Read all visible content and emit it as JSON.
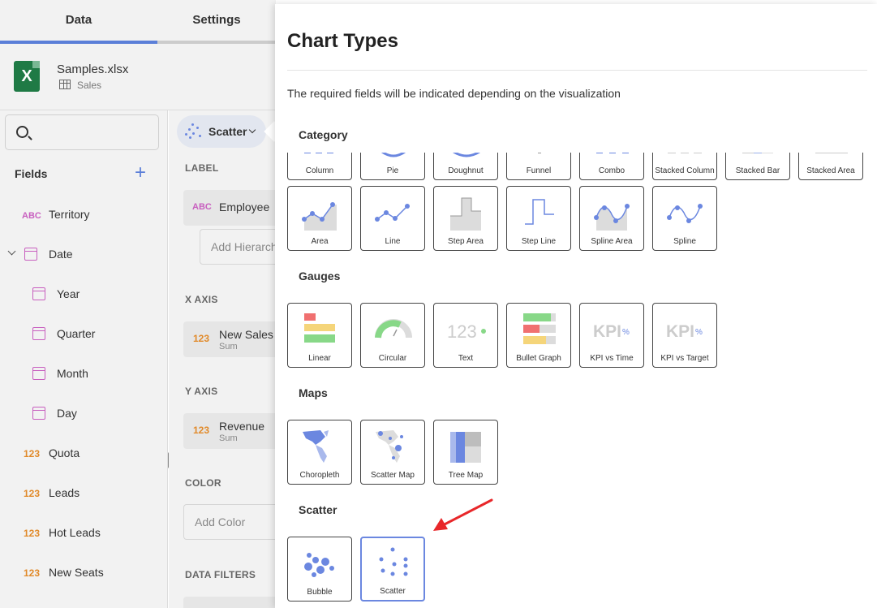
{
  "tabs": {
    "data": "Data",
    "settings": "Settings"
  },
  "source": {
    "file": "Samples.xlsx",
    "sheet": "Sales"
  },
  "fields_title": "Fields",
  "fields": [
    {
      "type": "ABC",
      "label": "Territory"
    },
    {
      "type": "date",
      "label": "Date"
    },
    {
      "type": "date",
      "label": "Year"
    },
    {
      "type": "date",
      "label": "Quarter"
    },
    {
      "type": "date",
      "label": "Month"
    },
    {
      "type": "date",
      "label": "Day"
    },
    {
      "type": "123",
      "label": "Quota"
    },
    {
      "type": "123",
      "label": "Leads"
    },
    {
      "type": "123",
      "label": "Hot Leads"
    },
    {
      "type": "123",
      "label": "New Seats"
    }
  ],
  "viz": {
    "selected": "Scatter",
    "label_section": "LABEL",
    "label_field": {
      "type": "ABC",
      "name": "Employee"
    },
    "hierarchy_placeholder": "Add Hierarchy",
    "x_axis_section": "X AXIS",
    "x_field": {
      "type": "123",
      "name": "New Sales",
      "agg": "Sum"
    },
    "y_axis_section": "Y AXIS",
    "y_field": {
      "type": "123",
      "name": "Revenue",
      "agg": "Sum"
    },
    "color_section": "COLOR",
    "color_placeholder": "Add Color",
    "filters_section": "DATA FILTERS"
  },
  "chart_types": {
    "title": "Chart Types",
    "description": "The required fields will be indicated depending on the visualization",
    "groups": {
      "category": {
        "name": "Category",
        "items_row1": [
          "Column",
          "Pie",
          "Doughnut",
          "Funnel",
          "Combo",
          "Stacked Column",
          "Stacked Bar",
          "Stacked Area"
        ],
        "items_row2": [
          "Area",
          "Line",
          "Step Area",
          "Step Line",
          "Spline Area",
          "Spline"
        ]
      },
      "gauges": {
        "name": "Gauges",
        "items": [
          "Linear",
          "Circular",
          "Text",
          "Bullet Graph",
          "KPI vs Time",
          "KPI vs Target"
        ]
      },
      "maps": {
        "name": "Maps",
        "items": [
          "Choropleth",
          "Scatter Map",
          "Tree Map"
        ]
      },
      "scatter": {
        "name": "Scatter",
        "items": [
          "Bubble",
          "Scatter"
        ]
      }
    },
    "gauge_text_sample": "123",
    "kpi_text": "KPI",
    "kpi_pct": "%",
    "selected_item": "Scatter"
  },
  "colors": {
    "accent": "#5b7fd8",
    "chart_blue": "#6b87e0",
    "excel_green": "#1f7a45",
    "abc_purple": "#c85fbf",
    "num_orange": "#e18a2a",
    "arrow_red": "#e8272a"
  }
}
